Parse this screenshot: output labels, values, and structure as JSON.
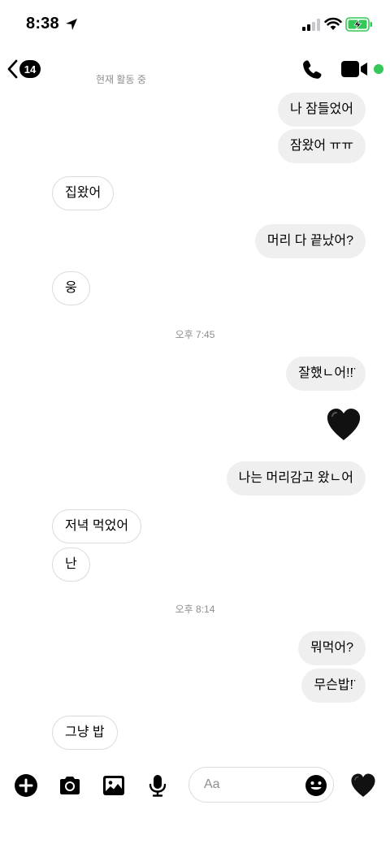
{
  "status_bar": {
    "time": "8:38"
  },
  "header": {
    "back_count": "14",
    "active_status": "현재 활동 중"
  },
  "messages": [
    {
      "id": "m1",
      "side": "out",
      "text": "나 잠들었어"
    },
    {
      "id": "m2",
      "side": "out",
      "text": "잠왔어 ㅠㅠ"
    },
    {
      "id": "m3",
      "side": "in",
      "text": "집왔어"
    },
    {
      "id": "m4",
      "side": "out",
      "text": "머리 다 끝났어?"
    },
    {
      "id": "m5",
      "side": "in",
      "text": "웅"
    },
    {
      "id": "t1",
      "type": "timestamp",
      "text": "오후 7:45"
    },
    {
      "id": "m6",
      "side": "out",
      "text": "잘했ㄴ어!!̈"
    },
    {
      "id": "r1",
      "type": "heart",
      "icon": "black-heart-icon"
    },
    {
      "id": "m7",
      "side": "out",
      "text": "나는 머리감고 왔ㄴ어"
    },
    {
      "id": "m8",
      "side": "in",
      "text": "저녁 먹었어"
    },
    {
      "id": "m9",
      "side": "in",
      "text": "난"
    },
    {
      "id": "t2",
      "type": "timestamp",
      "text": "오후 8:14"
    },
    {
      "id": "m10",
      "side": "out",
      "text": "뭐먹어?"
    },
    {
      "id": "m11",
      "side": "out",
      "text": "무슨밥!̈"
    },
    {
      "id": "m12",
      "side": "in",
      "text": "그냥 밥"
    }
  ],
  "composer": {
    "placeholder": "Aa",
    "icons": [
      "plus-circle-icon",
      "camera-icon",
      "image-icon",
      "microphone-icon",
      "emoji-icon",
      "heart-icon"
    ]
  },
  "colors": {
    "online": "#34c759",
    "bubble_out": "#efefef",
    "muted": "#8e8e93",
    "battery": "#34c759"
  }
}
